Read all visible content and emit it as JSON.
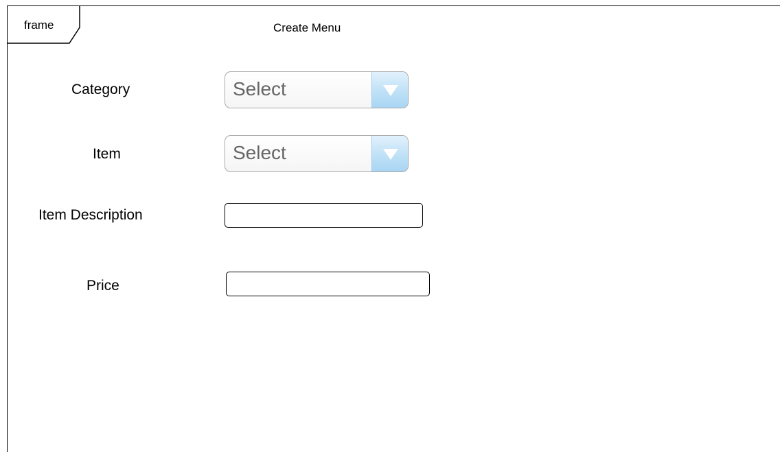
{
  "frame": {
    "label": "frame"
  },
  "page": {
    "title": "Create Menu"
  },
  "form": {
    "category": {
      "label": "Category",
      "value": "Select"
    },
    "item": {
      "label": "Item",
      "value": "Select"
    },
    "item_description": {
      "label": "Item Description",
      "value": ""
    },
    "price": {
      "label": "Price",
      "value": ""
    }
  },
  "icons": {
    "dropdown": "chevron-down-icon"
  },
  "colors": {
    "select_button_top": "#e2f1fc",
    "select_button_bottom": "#a9d5f3",
    "select_border": "#a9a9a9",
    "placeholder_text": "#666666"
  }
}
